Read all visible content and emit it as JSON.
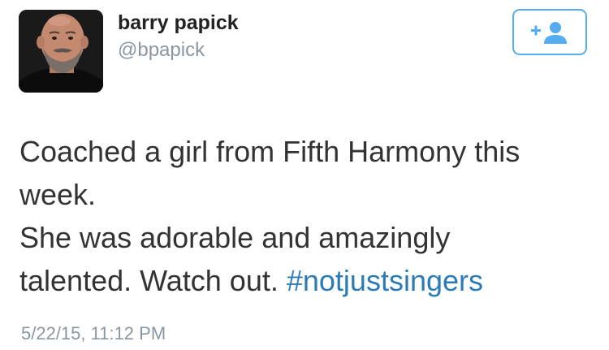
{
  "user": {
    "display_name": "barry papick",
    "handle": "@bpapick"
  },
  "follow_button": {
    "icon": "add-user-icon",
    "accent": "#55acee"
  },
  "tweet": {
    "line1": "Coached a girl from Fifth Harmony this",
    "line2": "week.",
    "line3": "She was adorable and amazingly",
    "line4_text": "talented. Watch out. ",
    "hashtag": "#notjustsingers",
    "timestamp": "5/22/15, 11:12 PM"
  },
  "colors": {
    "text": "#333333",
    "muted": "#8a96a0",
    "link": "#2b7bb9"
  }
}
